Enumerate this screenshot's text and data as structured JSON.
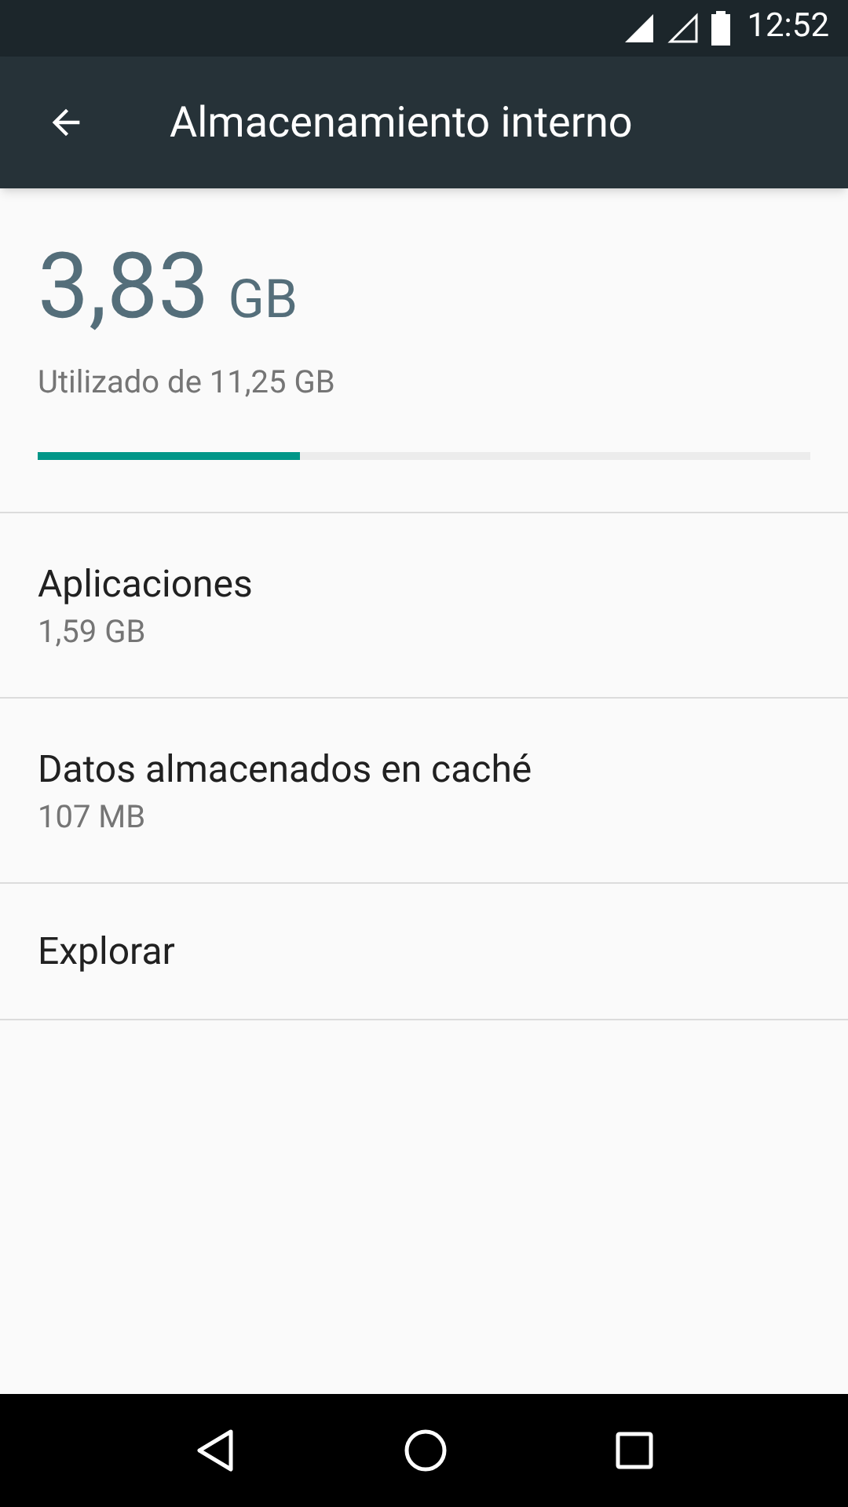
{
  "status_bar": {
    "time": "12:52"
  },
  "toolbar": {
    "title": "Almacenamiento interno"
  },
  "summary": {
    "used": "3,83",
    "unit": "GB",
    "caption": "Utilizado de 11,25 GB",
    "level": 0.34
  },
  "items": [
    {
      "title": "Aplicaciones",
      "subtitle": "1,59 GB"
    },
    {
      "title": "Datos almacenados en caché",
      "subtitle": "107 MB"
    },
    {
      "title": "Explorar"
    }
  ]
}
